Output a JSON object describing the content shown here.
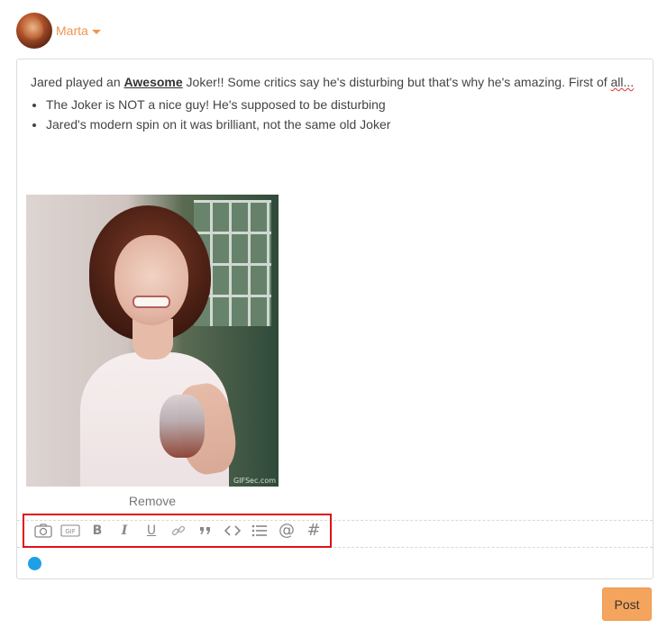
{
  "user": {
    "name": "Marta",
    "avatar_icon": "user-avatar"
  },
  "post": {
    "intro_before": "Jared played an ",
    "intro_bold": "Awesome",
    "intro_after": " Joker!! Some critics say he's disturbing but that's why he's amazing. First of ",
    "intro_misspelled": "all...",
    "bullets": [
      "The Joker is NOT a nice guy! He's supposed to be disturbing",
      "Jared's modern spin on it was brilliant, not the same old Joker"
    ]
  },
  "attachment": {
    "watermark": "GIFSec.com",
    "remove_label": "Remove"
  },
  "toolbar": {
    "highlight_color": "#e0101a",
    "buttons": [
      {
        "name": "camera-icon",
        "label": ""
      },
      {
        "name": "gif-icon",
        "label": "GIF"
      },
      {
        "name": "bold-icon",
        "label": "B"
      },
      {
        "name": "italic-icon",
        "label": "I"
      },
      {
        "name": "underline-icon",
        "label": "U"
      },
      {
        "name": "link-icon",
        "label": ""
      },
      {
        "name": "quote-icon",
        "label": ""
      },
      {
        "name": "code-icon",
        "label": ""
      },
      {
        "name": "list-icon",
        "label": ""
      },
      {
        "name": "mention-icon",
        "label": "@"
      },
      {
        "name": "hashtag-icon",
        "label": "#"
      }
    ]
  },
  "status": {
    "dot_color": "#1ea0e6"
  },
  "actions": {
    "post_label": "Post",
    "accent": "#f4a45c"
  }
}
